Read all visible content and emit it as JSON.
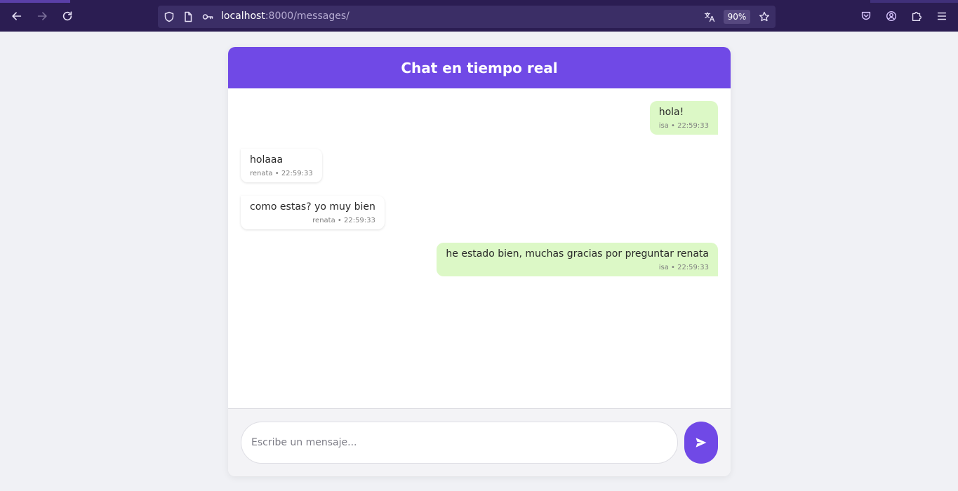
{
  "browser": {
    "url_host": "localhost",
    "url_path": ":8000/messages/",
    "zoom": "90%",
    "icons": [
      "back-icon",
      "forward-icon",
      "reload-icon",
      "shield-icon",
      "page-icon",
      "key-icon",
      "translate-icon",
      "star-icon",
      "pocket-icon",
      "account-icon",
      "extensions-icon",
      "menu-icon"
    ]
  },
  "chat": {
    "title": "Chat en tiempo real",
    "messages": [
      {
        "text": "hola!",
        "meta": "isa • 22:59:33",
        "type": "sent"
      },
      {
        "text": "holaaa",
        "meta": "renata • 22:59:33",
        "type": "received"
      },
      {
        "text": "como estas? yo muy bien",
        "meta": "renata • 22:59:33",
        "type": "received"
      },
      {
        "text": "he estado bien, muchas gracias por preguntar renata",
        "meta": "isa • 22:59:33",
        "type": "sent"
      }
    ],
    "input_placeholder": "Escribe un mensaje...",
    "input_value": "",
    "send_icon": "send-icon"
  },
  "colors": {
    "accent": "#7049e6",
    "sent_bubble": "#dcf8c6",
    "browser_toolbar": "#2b1d52"
  }
}
